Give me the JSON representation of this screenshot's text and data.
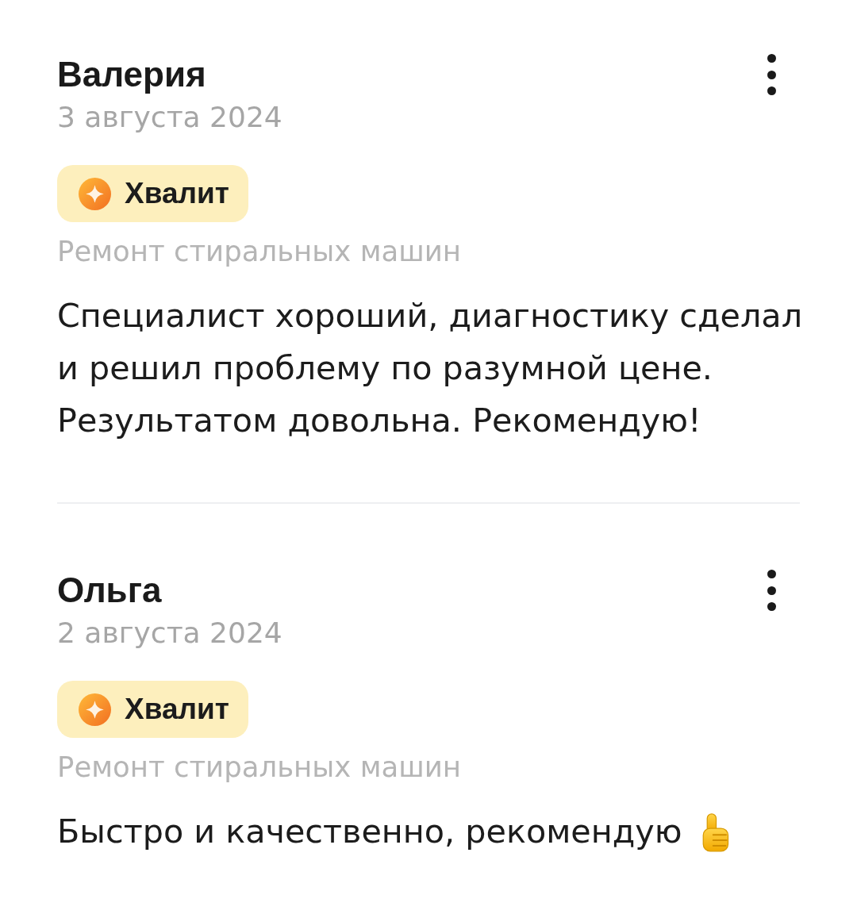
{
  "reviews": [
    {
      "author": "Валерия",
      "date": "3 августа 2024",
      "badge": {
        "label": "Хвалит"
      },
      "category": "Ремонт стиральных машин",
      "text": "Специалист хороший, диагностику сделал и решил проблему по разумной цене. Результатом довольна. Рекомендую!",
      "thumbs_up": false
    },
    {
      "author": "Ольга",
      "date": "2 августа 2024",
      "badge": {
        "label": "Хвалит"
      },
      "category": "Ремонт стиральных машин",
      "text": "Быстро и качественно, рекомендую",
      "thumbs_up": true
    }
  ]
}
